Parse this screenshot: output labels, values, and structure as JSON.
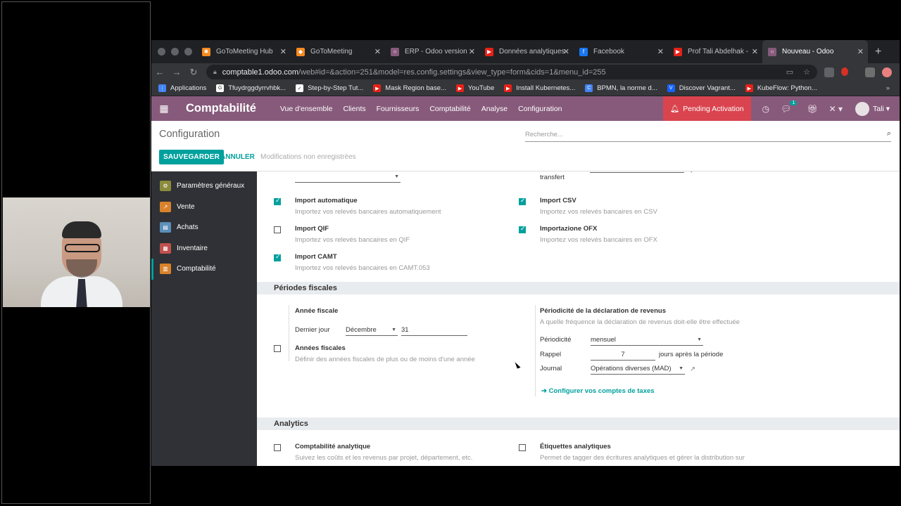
{
  "browser": {
    "tabs": [
      {
        "label": "GoToMeeting Hub",
        "color": "#f68b1f",
        "glyph": "✱"
      },
      {
        "label": "GoToMeeting",
        "color": "#f68b1f",
        "glyph": "◆"
      },
      {
        "label": "ERP - Odoo version",
        "color": "#875a7b",
        "glyph": "○"
      },
      {
        "label": "Données analytiques",
        "color": "#e62117",
        "glyph": "▶"
      },
      {
        "label": "Facebook",
        "color": "#1877f2",
        "glyph": "f"
      },
      {
        "label": "Prof Tali Abdelhak -",
        "color": "#e62117",
        "glyph": "▶"
      },
      {
        "label": "Nouveau - Odoo",
        "color": "#875a7b",
        "glyph": "○"
      }
    ],
    "url_host": "comptable1.odoo.com",
    "url_path": "/web#id=&action=251&model=res.config.settings&view_type=form&cids=1&menu_id=255",
    "bookmarks": [
      {
        "label": "Applications",
        "color": "#4285f4",
        "glyph": "⋮"
      },
      {
        "label": "Tfuydrggdyrrvhbk...",
        "color": "#ffffff",
        "glyph": "G"
      },
      {
        "label": "Step-by-Step Tut...",
        "color": "#ffffff",
        "glyph": "✓"
      },
      {
        "label": "Mask Region base...",
        "color": "#e62117",
        "glyph": "▶"
      },
      {
        "label": "YouTube",
        "color": "#e62117",
        "glyph": "▶"
      },
      {
        "label": "Install Kubernetes...",
        "color": "#e62117",
        "glyph": "▶"
      },
      {
        "label": "BPMN, la norme d...",
        "color": "#4285f4",
        "glyph": "C"
      },
      {
        "label": "Discover Vagrant...",
        "color": "#1563ff",
        "glyph": "V"
      },
      {
        "label": "KubeFlow: Python...",
        "color": "#e62117",
        "glyph": "▶"
      }
    ],
    "bookmarks_more": "»"
  },
  "odoo": {
    "brand": "Comptabilité",
    "menu": [
      "Vue d'ensemble",
      "Clients",
      "Fournisseurs",
      "Comptabilité",
      "Analyse",
      "Configuration"
    ],
    "pending": "Pending Activation",
    "chat_badge": "1",
    "user": "Tali"
  },
  "control": {
    "title": "Configuration",
    "search_placeholder": "Recherche...",
    "save": "SAUVEGARDER",
    "cancel": "ANNULER",
    "unsaved": "Modifications non enregistrées"
  },
  "sidebar": [
    {
      "label": "Paramètres généraux",
      "color": "#8b8b3c",
      "glyph": "⚙"
    },
    {
      "label": "Vente",
      "color": "#d9822b",
      "glyph": "↗"
    },
    {
      "label": "Achats",
      "color": "#5b8fb9",
      "glyph": "▤"
    },
    {
      "label": "Inventaire",
      "color": "#c0504d",
      "glyph": "▦"
    },
    {
      "label": "Comptabilité",
      "color": "#d9822b",
      "glyph": "▥"
    }
  ],
  "settings": {
    "transfer_label": "transfert",
    "import_auto": {
      "label": "Import automatique",
      "desc": "Importez vos relevés bancaires automatiquement",
      "checked": true
    },
    "import_csv": {
      "label": "Import CSV",
      "desc": "Importez vos relevés bancaires en CSV",
      "checked": true
    },
    "import_qif": {
      "label": "Import QIF",
      "desc": "Importez vos relevés bancaires en QIF",
      "checked": false
    },
    "import_ofx": {
      "label": "Importazione OFX",
      "desc": "Importez vos relevés bancaires en OFX",
      "checked": true
    },
    "import_camt": {
      "label": "Import CAMT",
      "desc": "Importez vos relevés bancaires en CAMT.053",
      "checked": true
    },
    "fiscal_section": "Périodes fiscales",
    "fiscal_year": "Année fiscale",
    "last_day": "Dernier jour",
    "month": "Décembre",
    "day": "31",
    "fiscal_years": {
      "label": "Années fiscales",
      "desc": "Définir des années fiscales de plus ou de moins d'une année",
      "checked": false
    },
    "tax_period": {
      "label": "Périodicité de la déclaration de revenus",
      "desc": "A quelle fréquence la déclaration de revenus doit-elle être effectuée"
    },
    "periodicity_label": "Périodicité",
    "periodicity_value": "mensuel",
    "reminder_label": "Rappel",
    "reminder_value": "7",
    "reminder_suffix": "jours après la période",
    "journal_label": "Journal",
    "journal_value": "Opérations diverses (MAD)",
    "tax_link": "Configurer vos comptes de taxes",
    "analytics_section": "Analytics",
    "analytic_acc": {
      "label": "Comptabilité analytique",
      "desc": "Suivez les coûts et les revenus par projet, département, etc.",
      "checked": false
    },
    "analytic_tags": {
      "label": "Étiquettes analytiques",
      "desc": "Permet de tagger des écritures analytiques et gérer la distribution sur",
      "checked": false
    }
  }
}
